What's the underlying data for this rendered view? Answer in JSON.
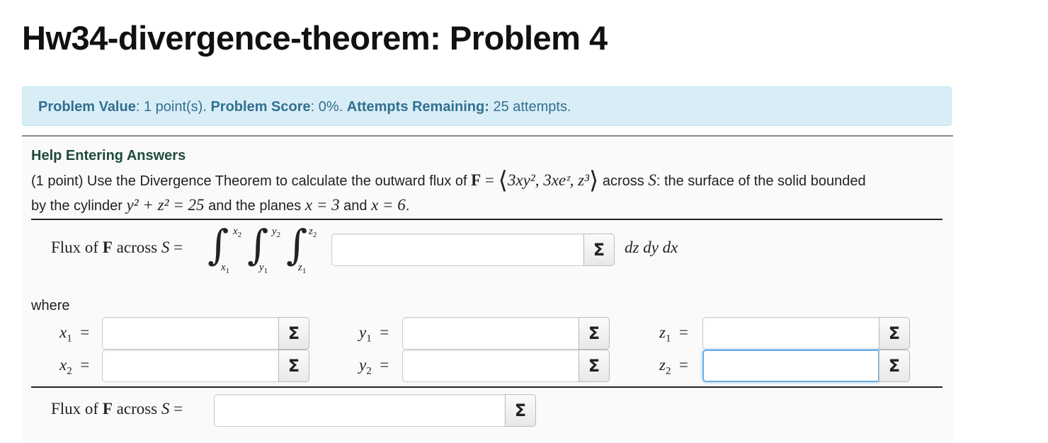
{
  "page_title": "Hw34-divergence-theorem: Problem 4",
  "info": {
    "value_label": "Problem Value",
    "value_text": ": 1 point(s). ",
    "score_label": "Problem Score",
    "score_text": ": 0%. ",
    "attempts_label": "Attempts Remaining:",
    "attempts_text": " 25 attempts."
  },
  "help_link": "Help Entering Answers",
  "problem": {
    "intro": "(1 point) Use the Divergence Theorem to calculate the outward flux of ",
    "F": "F",
    "eq": " = ",
    "field": "3xy², 3xeᶻ, z³",
    "across": " across ",
    "S": "S",
    "surface": ": the surface of the solid bounded",
    "line2a": "by the cylinder ",
    "cyl": "y² + z² = 25",
    "line2b": " and the planes ",
    "plane1": "x = 3",
    "and": " and ",
    "plane2": "x = 6",
    "period": "."
  },
  "flux_label_1": "Flux of",
  "flux_F": "F",
  "flux_across": "across",
  "flux_S": "S",
  "flux_eq": "=",
  "integral_limits": {
    "x_upper": "x",
    "x_upper_sub": "2",
    "x_lower": "x",
    "x_lower_sub": "1",
    "y_upper": "y",
    "y_upper_sub": "2",
    "y_lower": "y",
    "y_lower_sub": "1",
    "z_upper": "z",
    "z_upper_sub": "2",
    "z_lower": "z",
    "z_lower_sub": "1"
  },
  "differentials": "dz dy dx",
  "where_label": "where",
  "vars": {
    "x1": {
      "name": "x",
      "sub": "1",
      "eq": "="
    },
    "x2": {
      "name": "x",
      "sub": "2",
      "eq": "="
    },
    "y1": {
      "name": "y",
      "sub": "1",
      "eq": "="
    },
    "y2": {
      "name": "y",
      "sub": "2",
      "eq": "="
    },
    "z1": {
      "name": "z",
      "sub": "1",
      "eq": "="
    },
    "z2": {
      "name": "z",
      "sub": "2",
      "eq": "="
    }
  },
  "sigma_symbol": "Σ",
  "inputs": {
    "integrand": "",
    "x1": "",
    "x2": "",
    "y1": "",
    "y2": "",
    "z1": "",
    "z2": "",
    "flux": ""
  },
  "focused_input": "z2",
  "colors": {
    "info_bg": "#d9edf7",
    "info_text": "#31708f",
    "focus_border": "#66afe9",
    "help_text": "#1f4a3a"
  },
  "icons": {
    "equation_editor": "sigma-icon"
  }
}
